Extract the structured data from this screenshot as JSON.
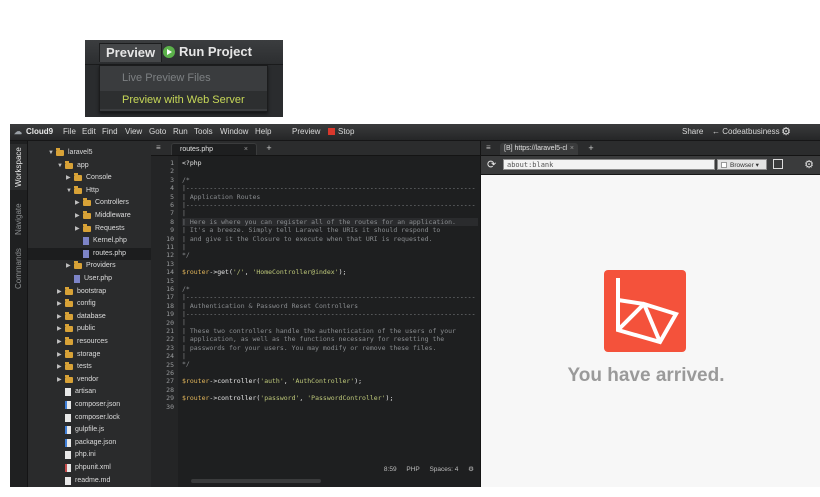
{
  "inset": {
    "preview_label": "Preview",
    "run_label": "Run Project",
    "menu": [
      "Live Preview Files",
      "Preview with Web Server"
    ]
  },
  "menubar": {
    "logo": "Cloud9",
    "items": [
      "File",
      "Edit",
      "Find",
      "View",
      "Goto",
      "Run",
      "Tools",
      "Window",
      "Help"
    ],
    "preview": "Preview",
    "stop": "Stop",
    "share": "Share",
    "user": "Codeatbusiness"
  },
  "sidetabs": [
    "Workspace",
    "Navigate",
    "Commands"
  ],
  "tree": [
    {
      "label": "laravel5",
      "type": "folder",
      "depth": 0,
      "open": true
    },
    {
      "label": "app",
      "type": "folder",
      "depth": 1,
      "open": true
    },
    {
      "label": "Console",
      "type": "folder",
      "depth": 2,
      "open": false
    },
    {
      "label": "Http",
      "type": "folder",
      "depth": 2,
      "open": true
    },
    {
      "label": "Controllers",
      "type": "folder",
      "depth": 3,
      "open": false
    },
    {
      "label": "Middleware",
      "type": "folder",
      "depth": 3,
      "open": false
    },
    {
      "label": "Requests",
      "type": "folder",
      "depth": 3,
      "open": false
    },
    {
      "label": "Kernel.php",
      "type": "php",
      "depth": 3
    },
    {
      "label": "routes.php",
      "type": "php",
      "depth": 3,
      "selected": true
    },
    {
      "label": "Providers",
      "type": "folder",
      "depth": 2,
      "open": false
    },
    {
      "label": "User.php",
      "type": "php",
      "depth": 2
    },
    {
      "label": "bootstrap",
      "type": "folder",
      "depth": 1,
      "open": false
    },
    {
      "label": "config",
      "type": "folder",
      "depth": 1,
      "open": false
    },
    {
      "label": "database",
      "type": "folder",
      "depth": 1,
      "open": false
    },
    {
      "label": "public",
      "type": "folder",
      "depth": 1,
      "open": false
    },
    {
      "label": "resources",
      "type": "folder",
      "depth": 1,
      "open": false
    },
    {
      "label": "storage",
      "type": "folder",
      "depth": 1,
      "open": false
    },
    {
      "label": "tests",
      "type": "folder",
      "depth": 1,
      "open": false
    },
    {
      "label": "vendor",
      "type": "folder",
      "depth": 1,
      "open": false
    },
    {
      "label": "artisan",
      "type": "plain",
      "depth": 1
    },
    {
      "label": "composer.json",
      "type": "json",
      "depth": 1
    },
    {
      "label": "composer.lock",
      "type": "plain",
      "depth": 1
    },
    {
      "label": "gulpfile.js",
      "type": "js",
      "depth": 1
    },
    {
      "label": "package.json",
      "type": "json",
      "depth": 1
    },
    {
      "label": "php.ini",
      "type": "plain",
      "depth": 1
    },
    {
      "label": "phpunit.xml",
      "type": "xml",
      "depth": 1
    },
    {
      "label": "readme.md",
      "type": "plain",
      "depth": 1
    }
  ],
  "editor": {
    "tab_label": "routes.php",
    "lines": [
      [
        [
          "t",
          "<?php"
        ]
      ],
      [
        [
          "t",
          ""
        ]
      ],
      [
        [
          "c",
          "/*"
        ]
      ],
      [
        [
          "c",
          "|--------------------------------------------------------------------------"
        ]
      ],
      [
        [
          "c",
          "| Application Routes"
        ]
      ],
      [
        [
          "c",
          "|--------------------------------------------------------------------------"
        ]
      ],
      [
        [
          "c",
          "|"
        ]
      ],
      [
        [
          "c",
          "| Here is where you can register all of the routes for an application."
        ]
      ],
      [
        [
          "c",
          "| It's a breeze. Simply tell Laravel the URIs it should respond to"
        ]
      ],
      [
        [
          "c",
          "| and give it the Closure to execute when that URI is requested."
        ]
      ],
      [
        [
          "c",
          "|"
        ]
      ],
      [
        [
          "c",
          "*/"
        ]
      ],
      [
        [
          "t",
          ""
        ]
      ],
      [
        [
          "v",
          "$router"
        ],
        [
          "t",
          "->get("
        ],
        [
          "s",
          "'/'"
        ],
        [
          "t",
          ", "
        ],
        [
          "s",
          "'HomeController@index'"
        ],
        [
          "t",
          ");"
        ]
      ],
      [
        [
          "t",
          ""
        ]
      ],
      [
        [
          "c",
          "/*"
        ]
      ],
      [
        [
          "c",
          "|--------------------------------------------------------------------------"
        ]
      ],
      [
        [
          "c",
          "| Authentication & Password Reset Controllers"
        ]
      ],
      [
        [
          "c",
          "|--------------------------------------------------------------------------"
        ]
      ],
      [
        [
          "c",
          "|"
        ]
      ],
      [
        [
          "c",
          "| These two controllers handle the authentication of the users of your"
        ]
      ],
      [
        [
          "c",
          "| application, as well as the functions necessary for resetting the"
        ]
      ],
      [
        [
          "c",
          "| passwords for your users. You may modify or remove these files."
        ]
      ],
      [
        [
          "c",
          "|"
        ]
      ],
      [
        [
          "c",
          "*/"
        ]
      ],
      [
        [
          "t",
          ""
        ]
      ],
      [
        [
          "v",
          "$router"
        ],
        [
          "t",
          "->controller("
        ],
        [
          "s",
          "'auth'"
        ],
        [
          "t",
          ", "
        ],
        [
          "s",
          "'AuthController'"
        ],
        [
          "t",
          ");"
        ]
      ],
      [
        [
          "t",
          ""
        ]
      ],
      [
        [
          "v",
          "$router"
        ],
        [
          "t",
          "->controller("
        ],
        [
          "s",
          "'password'"
        ],
        [
          "t",
          ", "
        ],
        [
          "s",
          "'PasswordController'"
        ],
        [
          "t",
          ");"
        ]
      ],
      [
        [
          "t",
          ""
        ]
      ]
    ],
    "highlighted_line": 8,
    "status": {
      "position": "8:59",
      "language": "PHP",
      "spaces": "Spaces: 4"
    }
  },
  "preview": {
    "tab_label": "[B] https://laravel5-cl",
    "url": "about:blank",
    "browser": "Browser",
    "message": "You have arrived.",
    "logo_color": "#f4523b"
  }
}
